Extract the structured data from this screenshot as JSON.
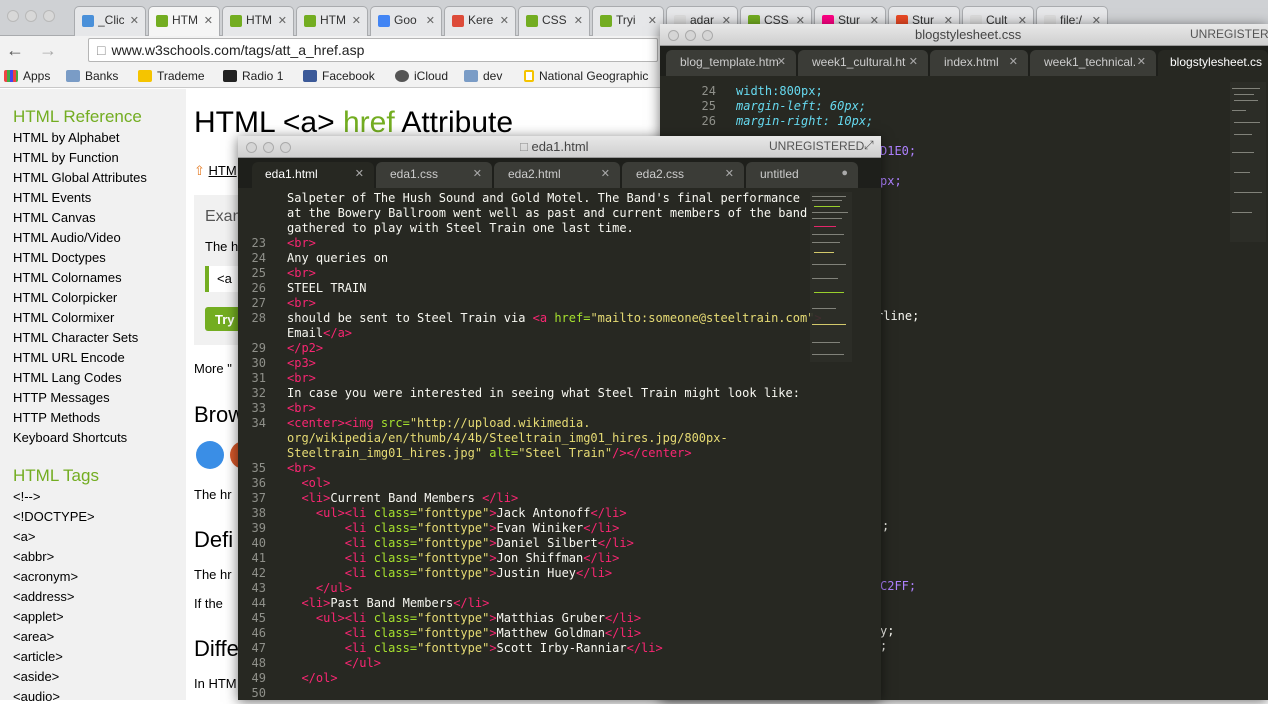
{
  "browser": {
    "tabs": [
      {
        "label": "_Click",
        "fav": "#4a90d9"
      },
      {
        "label": "HTM",
        "fav": "#73ad21"
      },
      {
        "label": "HTM",
        "fav": "#73ad21"
      },
      {
        "label": "HTM",
        "fav": "#73ad21"
      },
      {
        "label": "Goo",
        "fav": "#4285f4"
      },
      {
        "label": "Kere",
        "fav": "#dd4b39"
      },
      {
        "label": "CSS",
        "fav": "#73ad21"
      },
      {
        "label": "Tryi",
        "fav": "#73ad21"
      },
      {
        "label": "adar",
        "fav": "#dddddd"
      },
      {
        "label": "CSS",
        "fav": "#73ad21"
      },
      {
        "label": "Stur",
        "fav": "#ff0084"
      },
      {
        "label": "Stur",
        "fav": "#eb4924"
      },
      {
        "label": "Cult",
        "fav": "#dddddd"
      },
      {
        "label": "file:/",
        "fav": "#dddddd"
      }
    ],
    "url": "www.w3schools.com/tags/att_a_href.asp",
    "bookmarks": [
      "Apps",
      "Banks",
      "Trademe",
      "Radio 1",
      "Facebook",
      "iCloud",
      "dev",
      "National Geographic"
    ]
  },
  "sidebar": {
    "ref_heading": "HTML Reference",
    "ref_items": [
      "HTML by Alphabet",
      "HTML by Function",
      "HTML Global Attributes",
      "HTML Events",
      "HTML Canvas",
      "HTML Audio/Video",
      "HTML Doctypes",
      "HTML Colornames",
      "HTML Colorpicker",
      "HTML Colormixer",
      "HTML Character Sets",
      "HTML URL Encode",
      "HTML Lang Codes",
      "HTTP Messages",
      "HTTP Methods",
      "Keyboard Shortcuts"
    ],
    "tags_heading": "HTML Tags",
    "tag_items": [
      "<!-->",
      "<!DOCTYPE>",
      "<a>",
      "<abbr>",
      "<acronym>",
      "<address>",
      "<applet>",
      "<area>",
      "<article>",
      "<aside>",
      "<audio>"
    ]
  },
  "page": {
    "title_a": "HTML <a> ",
    "title_b": "href",
    "title_c": " Attribute",
    "link_html": "HTM",
    "exam": "Exam",
    "the_h": "The h",
    "code_a": "<a",
    "try": "Try",
    "more": "More \"",
    "brow": "Brow",
    "the_hr1": "The hr",
    "defi": "Defi",
    "the_hr2": "The hr",
    "if_the": "If the",
    "diffe": "Diffe",
    "in_htm": "In HTM"
  },
  "blog": {
    "title": "blogstylesheet.css",
    "unreg": "UNREGISTERED",
    "tabs": [
      "blog_template.htm",
      "week1_cultural.ht",
      "index.html",
      "week1_technical.",
      "blogstylesheet.cs"
    ],
    "lines": [
      "24",
      "25",
      "26"
    ],
    "code": [
      "width:800px;",
      "margin-left: 60px;",
      "margin-right: 10px;"
    ],
    "frag1": "D1E0;",
    "frag2": "px;",
    "frag3": "rline;",
    "frag4": ";",
    "frag5": "C2FF;",
    "frag6": "y;",
    "frag7": ";"
  },
  "eda": {
    "title": "eda1.html",
    "unreg": "UNREGISTERED",
    "tabs": [
      "eda1.html",
      "eda1.css",
      "eda2.html",
      "eda2.css",
      "untitled"
    ],
    "pre1": "Salpeter of The Hush Sound and Gold Motel. The Band's final performance",
    "pre2": "at the Bowery Ballroom went well as past and current members of the band",
    "pre3": "gathered to play with Steel Train one last time.",
    "ln": [
      "23",
      "24",
      "25",
      "26",
      "27",
      "28",
      "29",
      "30",
      "31",
      "32",
      "33",
      "34",
      "35",
      "36",
      "37",
      "38",
      "39",
      "40",
      "41",
      "42",
      "43",
      "44",
      "45",
      "46",
      "47",
      "48",
      "49",
      "50"
    ],
    "l23": "<br>",
    "l24": "Any queries on",
    "l25": "<br>",
    "l26": "STEEL TRAIN",
    "l27": "<br>",
    "l28a": "should be sent to Steel Train via ",
    "l28href": "href=",
    "l28val": "\"mailto:someone@steeltrain.com\"",
    "l28b": "Email",
    "l29": "</p2>",
    "l30": "<p3>",
    "l31": "<br>",
    "l32": "In case you were interested in seeing what Steel Train might look like:",
    "l33": "<br>",
    "l34src": "\"http://upload.wikimedia.",
    "l34b": "org/wikipedia/en/thumb/4/4b/Steeltrain_img01_hires.jpg/800px-",
    "l34c": "Steeltrain_img01_hires.jpg\"",
    "l34alt": "\"Steel Train\"",
    "l35": "<br>",
    "l36": "<ol>",
    "l37": "Current Band Members ",
    "members": [
      "Jack Antonoff",
      "Evan Winiker",
      "Daniel Silbert",
      "Jon Shiffman",
      "Justin Huey"
    ],
    "l44": "Past Band Members",
    "past": [
      "Matthias Gruber",
      "Matthew Goldman",
      "Scott Irby-Ranniar"
    ],
    "cls": "\"fonttype\""
  }
}
